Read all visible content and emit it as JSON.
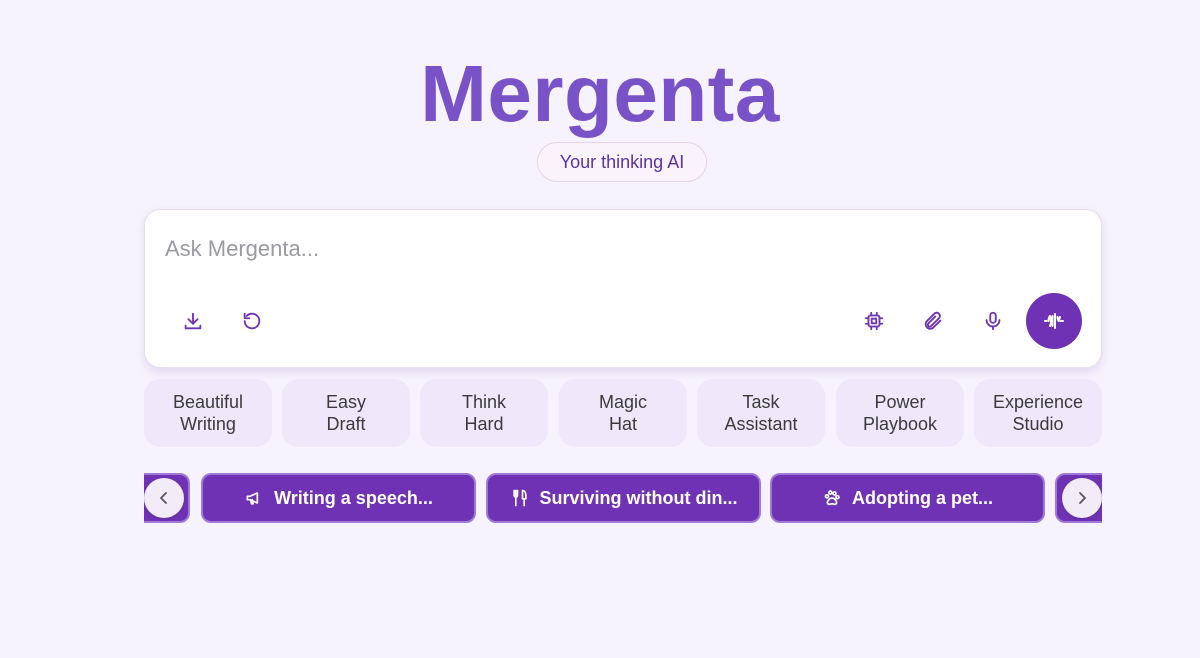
{
  "app": {
    "title": "Mergenta",
    "tagline": "Your thinking AI"
  },
  "ask": {
    "placeholder": "Ask Mergenta...",
    "value": ""
  },
  "toolbar": {
    "left_icons": [
      "download-icon",
      "refresh-icon"
    ],
    "right_icons": [
      "chip-icon",
      "paperclip-icon",
      "microphone-icon",
      "voice-wave-icon"
    ]
  },
  "modes": [
    {
      "line1": "Beautiful",
      "line2": "Writing"
    },
    {
      "line1": "Easy",
      "line2": "Draft"
    },
    {
      "line1": "Think",
      "line2": "Hard"
    },
    {
      "line1": "Magic",
      "line2": "Hat"
    },
    {
      "line1": "Task",
      "line2": "Assistant"
    },
    {
      "line1": "Power",
      "line2": "Playbook"
    },
    {
      "line1": "Experience",
      "line2": "Studio"
    }
  ],
  "prompts": [
    {
      "label": "Writing a speech...",
      "icon": "megaphone-icon"
    },
    {
      "label": "Surviving without din...",
      "icon": "fork-knife-icon"
    },
    {
      "label": "Adopting a pet...",
      "icon": "paw-icon"
    }
  ],
  "colors": {
    "background": "#f7f3fe",
    "brand": "#7a52c7",
    "accent": "#6f32b4",
    "chip": "#efe8fb"
  }
}
